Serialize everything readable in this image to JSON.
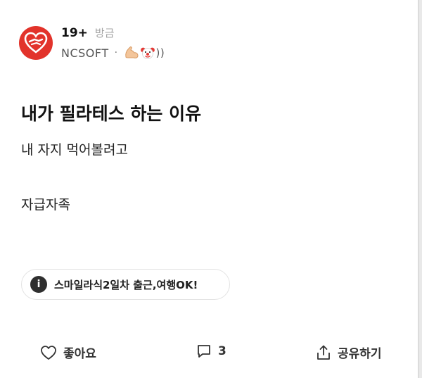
{
  "post": {
    "author": {
      "age_badge": "19+",
      "time": "방금",
      "company": "NCSOFT",
      "separator": "·",
      "flair_icons": [
        "flexed-biceps-icon",
        "clown-face-icon"
      ],
      "flair_suffix": "))",
      "avatar_colors": {
        "background": "#e2332b",
        "figure": "#ffffff"
      }
    },
    "title": "내가 필라테스 하는 이유",
    "body": [
      "내 자지 먹어볼려고",
      "자급자족"
    ],
    "tag": {
      "icon": "info-icon",
      "label": "스마일라식2일차 출근,여행OK!"
    },
    "actions": {
      "like": {
        "icon": "heart-icon",
        "label": "좋아요"
      },
      "comment": {
        "icon": "comment-icon",
        "count": "3"
      },
      "share": {
        "icon": "share-icon",
        "label": "공유하기"
      }
    }
  }
}
